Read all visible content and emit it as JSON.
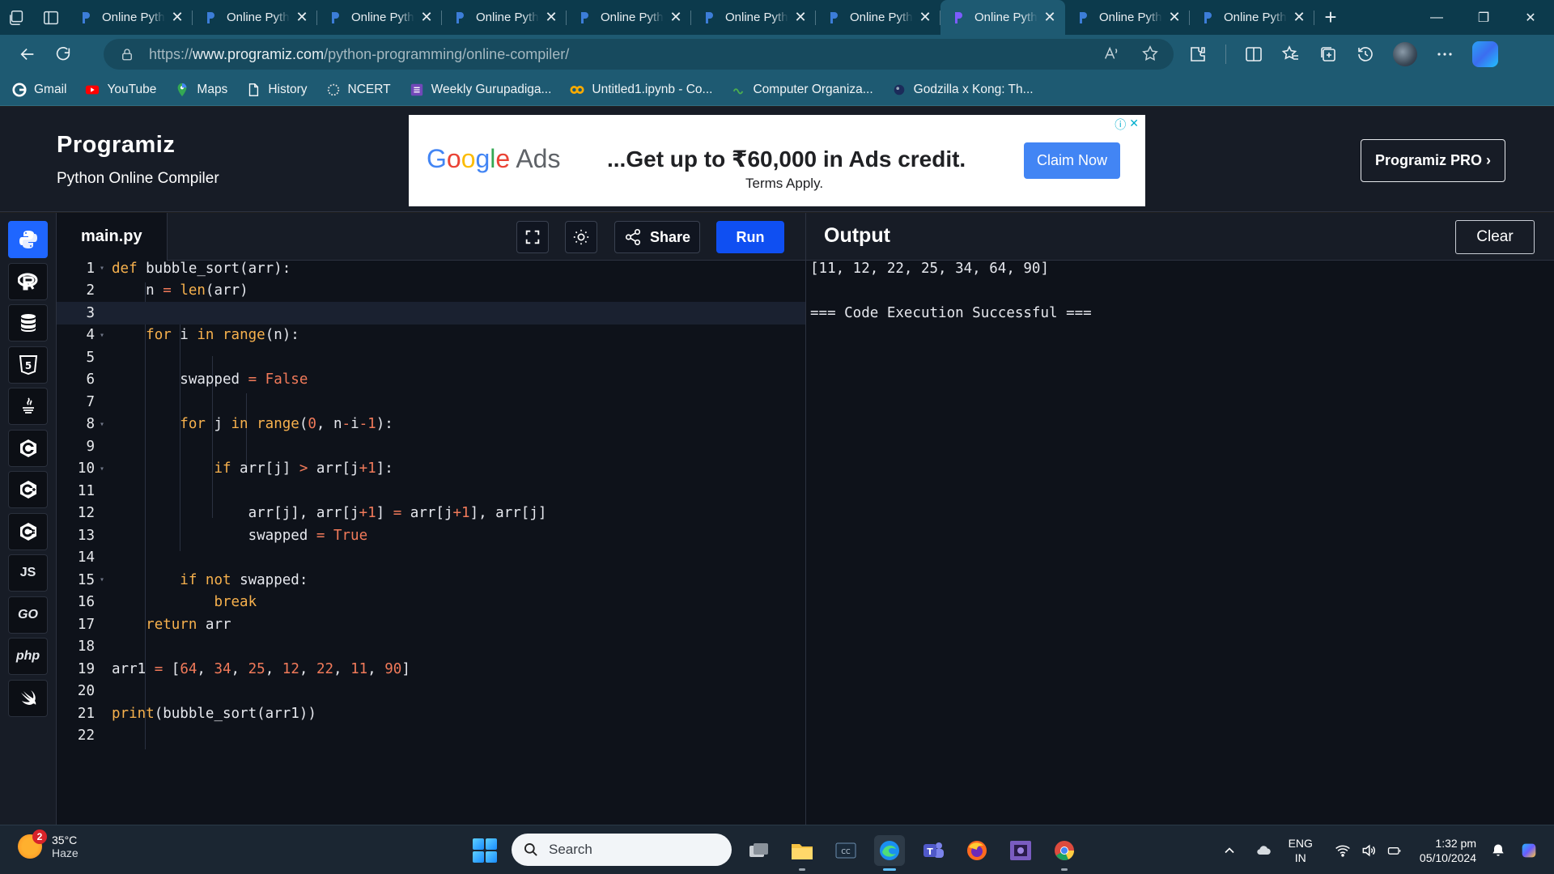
{
  "browser": {
    "tabs": [
      {
        "title": "Online Python",
        "active": false
      },
      {
        "title": "Online Python",
        "active": false
      },
      {
        "title": "Online Python",
        "active": false
      },
      {
        "title": "Online Python",
        "active": false
      },
      {
        "title": "Online Python",
        "active": false
      },
      {
        "title": "Online Python",
        "active": false
      },
      {
        "title": "Online Python",
        "active": false
      },
      {
        "title": "Online Python",
        "active": true
      },
      {
        "title": "Online Python",
        "active": false
      },
      {
        "title": "Online Python",
        "active": false
      }
    ],
    "tab_close": "✕",
    "new_tab": "+",
    "url_scheme": "https://",
    "url_host": "www.programiz.com",
    "url_path": "/python-programming/online-compiler/",
    "bookmarks": [
      {
        "label": "Gmail",
        "icon": "google-icon"
      },
      {
        "label": "YouTube",
        "icon": "youtube-icon"
      },
      {
        "label": "Maps",
        "icon": "maps-icon"
      },
      {
        "label": "History",
        "icon": "page-icon"
      },
      {
        "label": "NCERT",
        "icon": "ncert-icon"
      },
      {
        "label": "Weekly Gurupadiga...",
        "icon": "forms-icon"
      },
      {
        "label": "Untitled1.ipynb - Co...",
        "icon": "colab-icon"
      },
      {
        "label": "Computer Organiza...",
        "icon": "link-icon"
      },
      {
        "label": "Godzilla x Kong: Th...",
        "icon": "movie-icon"
      }
    ]
  },
  "header": {
    "logo": "Programiz",
    "subtitle": "Python Online Compiler",
    "pro_button": "Programiz PRO ›"
  },
  "ad": {
    "brand": "Google Ads",
    "headline": "...Get up to ₹60,000 in Ads credit.",
    "terms": "Terms Apply.",
    "cta": "Claim Now"
  },
  "editor": {
    "filename": "main.py",
    "share_label": "Share",
    "run_label": "Run",
    "current_line": 3
  },
  "output": {
    "title": "Output",
    "clear_label": "Clear",
    "lines": [
      "[11, 12, 22, 25, 34, 64, 90]",
      "",
      "=== Code Execution Successful ==="
    ]
  },
  "languages": [
    "python",
    "r",
    "sql",
    "html",
    "java",
    "c",
    "cpp",
    "csharp",
    "js",
    "go",
    "php",
    "swift"
  ],
  "languages_text": {
    "js": "JS",
    "go": "GO",
    "php": "php"
  },
  "taskbar": {
    "temperature": "35°C",
    "weather": "Haze",
    "weather_badge": "2",
    "search_placeholder": "Search",
    "lang_top": "ENG",
    "lang_bottom": "IN",
    "time": "1:32 pm",
    "date": "05/10/2024"
  },
  "colors": {
    "run": "#0f4ff2",
    "keyword": "#f7b14d",
    "number": "#f17a5a",
    "editor_bg": "#0e121a"
  }
}
